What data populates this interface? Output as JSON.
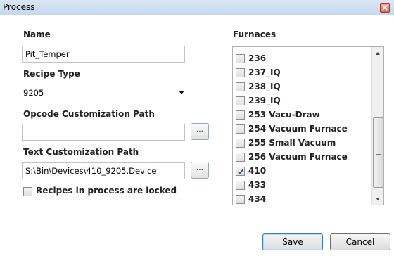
{
  "window": {
    "title": "Process"
  },
  "form": {
    "name_label": "Name",
    "name_value": "Pit_Temper",
    "recipe_type_label": "Recipe Type",
    "recipe_type_value": "9205",
    "opcode_path_label": "Opcode Customization Path",
    "opcode_path_value": "",
    "text_path_label": "Text Customization Path",
    "text_path_value": "S:\\Bin\\Devices\\410_9205.Device",
    "browse_label": "...",
    "locked_label": "Recipes in process are locked",
    "locked_checked": false
  },
  "furnaces": {
    "label": "Furnaces",
    "items": [
      {
        "label": "236",
        "checked": false
      },
      {
        "label": "237_IQ",
        "checked": false
      },
      {
        "label": "238_IQ",
        "checked": false
      },
      {
        "label": "239_IQ",
        "checked": false
      },
      {
        "label": "253 Vacu-Draw",
        "checked": false
      },
      {
        "label": "254 Vacuum Furnace",
        "checked": false
      },
      {
        "label": "255 Small Vacuum",
        "checked": false
      },
      {
        "label": "256 Vacuum Furnace",
        "checked": false
      },
      {
        "label": "410",
        "checked": true
      },
      {
        "label": "433",
        "checked": false
      },
      {
        "label": "434",
        "checked": false
      }
    ]
  },
  "buttons": {
    "save": "Save",
    "cancel": "Cancel"
  }
}
